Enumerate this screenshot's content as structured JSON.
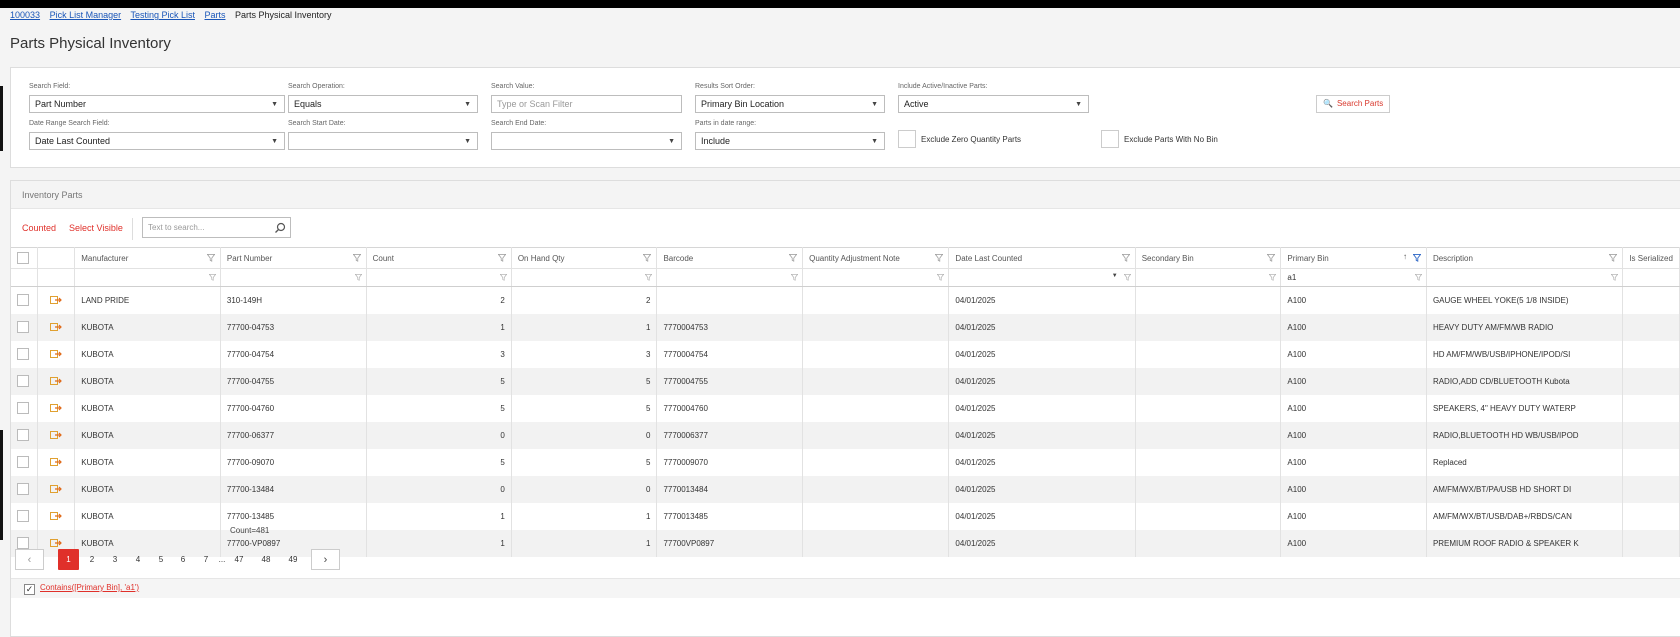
{
  "breadcrumb": {
    "items": [
      "100033",
      "Pick List Manager",
      "Testing Pick List",
      "Parts"
    ],
    "current": "Parts Physical Inventory"
  },
  "page_title": "Parts Physical Inventory",
  "search": {
    "search_field": {
      "label": "Search Field:",
      "value": "Part Number"
    },
    "search_operation": {
      "label": "Search Operation:",
      "value": "Equals"
    },
    "search_value": {
      "label": "Search Value:",
      "placeholder": "Type or Scan Filter"
    },
    "results_sort_order": {
      "label": "Results Sort Order:",
      "value": "Primary Bin Location"
    },
    "include_active": {
      "label": "Include Active/Inactive Parts:",
      "value": "Active"
    },
    "search_button": "Search Parts",
    "date_range_field": {
      "label": "Date Range Search Field:",
      "value": "Date Last Counted"
    },
    "start_date": {
      "label": "Search Start Date:",
      "value": ""
    },
    "end_date": {
      "label": "Search End Date:",
      "value": ""
    },
    "parts_in_date_range": {
      "label": "Parts in date range:",
      "value": "Include"
    },
    "exclude_zero": "Exclude Zero Quantity Parts",
    "exclude_no_bin": "Exclude Parts With No Bin"
  },
  "grid": {
    "title": "Inventory Parts",
    "toolbar": {
      "counted": "Counted",
      "select_visible": "Select Visible",
      "search_placeholder": "Text to search..."
    },
    "columns": [
      "Manufacturer",
      "Part Number",
      "Count",
      "On Hand Qty",
      "Barcode",
      "Quantity Adjustment Note",
      "Date Last Counted",
      "Secondary Bin",
      "Primary Bin",
      "Description",
      "Is Serialized"
    ],
    "primary_bin_filter": "a1",
    "rows": [
      {
        "manufacturer": "LAND PRIDE",
        "part": "310-149H",
        "count": "2",
        "onhand": "2",
        "barcode": "",
        "note": "",
        "date": "04/01/2025",
        "secondary": "",
        "primary": "A100",
        "desc": "GAUGE WHEEL YOKE(5 1/8 INSIDE)"
      },
      {
        "manufacturer": "KUBOTA",
        "part": "77700-04753",
        "count": "1",
        "onhand": "1",
        "barcode": "7770004753",
        "note": "",
        "date": "04/01/2025",
        "secondary": "",
        "primary": "A100",
        "desc": "HEAVY DUTY AM/FM/WB RADIO"
      },
      {
        "manufacturer": "KUBOTA",
        "part": "77700-04754",
        "count": "3",
        "onhand": "3",
        "barcode": "7770004754",
        "note": "",
        "date": "04/01/2025",
        "secondary": "",
        "primary": "A100",
        "desc": "HD AM/FM/WB/USB/IPHONE/IPOD/SI"
      },
      {
        "manufacturer": "KUBOTA",
        "part": "77700-04755",
        "count": "5",
        "onhand": "5",
        "barcode": "7770004755",
        "note": "",
        "date": "04/01/2025",
        "secondary": "",
        "primary": "A100",
        "desc": "RADIO,ADD CD/BLUETOOTH Kubota"
      },
      {
        "manufacturer": "KUBOTA",
        "part": "77700-04760",
        "count": "5",
        "onhand": "5",
        "barcode": "7770004760",
        "note": "",
        "date": "04/01/2025",
        "secondary": "",
        "primary": "A100",
        "desc": "SPEAKERS, 4\" HEAVY DUTY WATERP"
      },
      {
        "manufacturer": "KUBOTA",
        "part": "77700-06377",
        "count": "0",
        "onhand": "0",
        "barcode": "7770006377",
        "note": "",
        "date": "04/01/2025",
        "secondary": "",
        "primary": "A100",
        "desc": "RADIO,BLUETOOTH HD WB/USB/IPOD"
      },
      {
        "manufacturer": "KUBOTA",
        "part": "77700-09070",
        "count": "5",
        "onhand": "5",
        "barcode": "7770009070",
        "note": "",
        "date": "04/01/2025",
        "secondary": "",
        "primary": "A100",
        "desc": "Replaced"
      },
      {
        "manufacturer": "KUBOTA",
        "part": "77700-13484",
        "count": "0",
        "onhand": "0",
        "barcode": "7770013484",
        "note": "",
        "date": "04/01/2025",
        "secondary": "",
        "primary": "A100",
        "desc": "AM/FM/WX/BT/PA/USB HD SHORT DI"
      },
      {
        "manufacturer": "KUBOTA",
        "part": "77700-13485",
        "count": "1",
        "onhand": "1",
        "barcode": "7770013485",
        "note": "",
        "date": "04/01/2025",
        "secondary": "",
        "primary": "A100",
        "desc": "AM/FM/WX/BT/USB/DAB+/RBDS/CAN"
      },
      {
        "manufacturer": "KUBOTA",
        "part": "77700-VP0897",
        "count": "1",
        "onhand": "1",
        "barcode": "77700VP0897",
        "note": "",
        "date": "04/01/2025",
        "secondary": "",
        "primary": "A100",
        "desc": "PREMIUM ROOF RADIO & SPEAKER K"
      }
    ],
    "count_summary": "Count=481",
    "pager": {
      "prev": "‹",
      "pages": [
        "1",
        "2",
        "3",
        "4",
        "5",
        "6",
        "7",
        "...",
        "47",
        "48",
        "49"
      ],
      "next": "›",
      "active": "1"
    },
    "filter_expression": "Contains([Primary Bin], 'a1')"
  },
  "colors": {
    "accent": "#e0302a",
    "link": "#1a56b8",
    "funnel_active": "#2a64c5"
  }
}
